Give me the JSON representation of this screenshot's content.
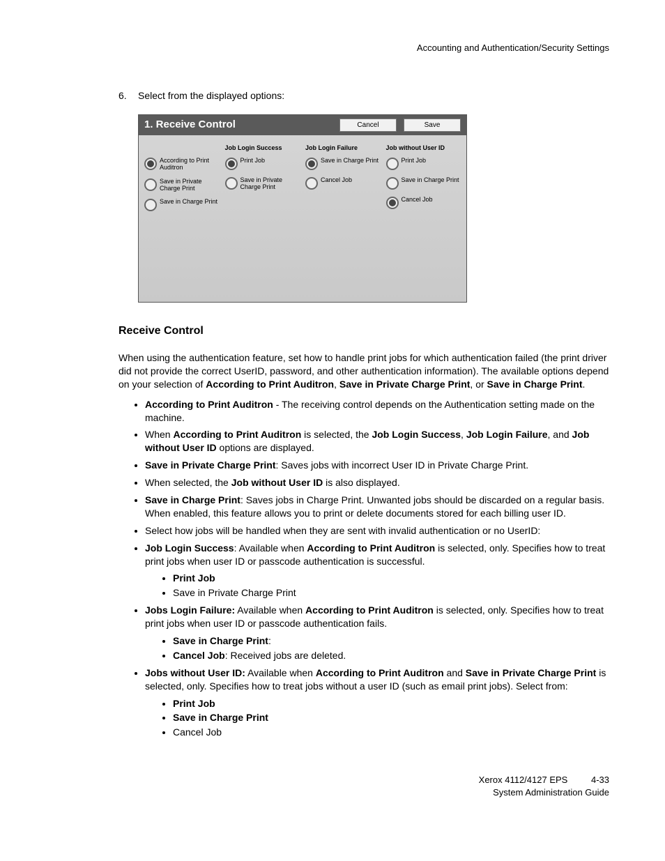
{
  "header": "Accounting and Authentication/Security Settings",
  "step": {
    "num": "6.",
    "text": "Select from the displayed options:"
  },
  "panel": {
    "title": "1. Receive Control",
    "cancel": "Cancel",
    "save": "Save",
    "cols": {
      "c0": {
        "o0": "According to Print Auditron",
        "o1": "Save in Private Charge Print",
        "o2": "Save in Charge Print"
      },
      "c1": {
        "head": "Job Login Success",
        "o0": "Print Job",
        "o1": "Save in Private Charge Print"
      },
      "c2": {
        "head": "Job Login Failure",
        "o0": "Save in Charge Print",
        "o1": "Cancel Job"
      },
      "c3": {
        "head": "Job without User ID",
        "o0": "Print Job",
        "o1": "Save in Charge Print",
        "o2": "Cancel Job"
      }
    }
  },
  "section_title": "Receive Control",
  "intro": {
    "p1a": "When using the authentication feature, set how to handle print jobs for which authentication failed (the print driver did not provide the correct UserID, password, and other authentication information). The available options depend on your selection of ",
    "b1": "According to Print Auditron",
    "p1b": ", ",
    "b2": "Save in Private Charge Print",
    "p1c": ", or ",
    "b3": "Save in Charge Print",
    "p1d": "."
  },
  "bul": {
    "i1": {
      "b": "According to Print Auditron",
      "t": " - The receiving control depends on the Authentication setting made on the machine."
    },
    "i2": {
      "t1": "When ",
      "b1": "According to Print Auditron",
      "t2": " is selected, the ",
      "b2": "Job Login Success",
      "t3": ", ",
      "b3": "Job Login Failure",
      "t4": ", and ",
      "b4": "Job without User ID",
      "t5": " options are displayed."
    },
    "i3": {
      "b": "Save in Private Charge Print",
      "t": ": Saves jobs with incorrect User ID in Private Charge Print."
    },
    "i4": {
      "t1": "When selected, the ",
      "b1": "Job without User ID",
      "t2": " is also displayed."
    },
    "i5": {
      "b": "Save in Charge Print",
      "t": ": Saves jobs in Charge Print. Unwanted jobs should be discarded on a regular basis. When enabled, this feature allows you to print or delete documents stored for each billing user ID."
    },
    "i6": {
      "t": "Select how jobs will be handled when they are sent with invalid authentication or no UserID:"
    },
    "i7": {
      "b1": "Job Login Success",
      "t1": ": Available when ",
      "b2": "According to Print Auditron",
      "t2": " is selected, only. Specifies how to treat print jobs when user ID or passcode authentication is successful.",
      "sub": {
        "s1b": "Print Job",
        "s2": "Save in Private Charge Print"
      }
    },
    "i8": {
      "b1": "Jobs Login Failure:",
      "t1": " Available when ",
      "b2": "According to Print Auditron",
      "t2": " is selected, only. Specifies how to treat print jobs when user ID or passcode authentication fails.",
      "sub": {
        "s1b": "Save in Charge Print",
        "s1t": ":",
        "s2b": "Cancel Job",
        "s2t": ": Received jobs are deleted."
      }
    },
    "i9": {
      "b1": "Jobs without User ID:",
      "t1": "   Available when ",
      "b2": "According to Print Auditron",
      "t2": " and ",
      "b3": "Save in Private Charge Print",
      "t3": " is selected, only. Specifies how to treat jobs without a user ID (such as email print jobs). Select from:",
      "sub": {
        "s1b": "Print Job",
        "s2b": "Save in Charge Print",
        "s3": "Cancel Job"
      }
    }
  },
  "footer": {
    "l1": "Xerox 4112/4127 EPS",
    "pg": "4-33",
    "l2": "System Administration Guide"
  }
}
